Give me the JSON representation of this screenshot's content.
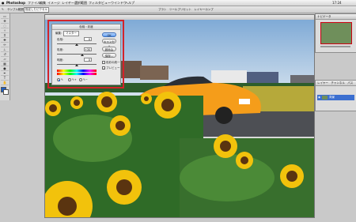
{
  "menubar": {
    "app_name": "Photoshop",
    "items": [
      "ファイル",
      "編集",
      "イメージ",
      "レイヤー",
      "選択範囲",
      "フィルタ",
      "ビュー",
      "ウインドウ",
      "ヘルプ"
    ],
    "clock": "17:24"
  },
  "options_bar": {
    "sample_label": "サンプル範囲：",
    "sample_value": "指定したピクセル",
    "right_tabs": "ブラシ　ツールプリセット　レイヤーカンプ"
  },
  "document": {
    "title": "",
    "colors": {
      "sky": "#a9c8e6",
      "field": "#3f7a2c",
      "sunflower": "#f2c20c",
      "car": "#f59d1a"
    }
  },
  "dialog": {
    "title": "色相・彩度",
    "edit_label": "編集：",
    "edit_value": "マスター",
    "hue_label": "色相：",
    "hue_value": "0",
    "saturation_label": "彩度：",
    "saturation_value": "+30",
    "lightness_label": "明度：",
    "lightness_value": "0",
    "ok_label": "OK",
    "cancel_label": "キャンセル",
    "load_label": "読み込み...",
    "save_label": "保存...",
    "colorize_label": "色彩の統一",
    "preview_label": "プレビュー",
    "preview_checked": true
  },
  "panels": {
    "navigator_title": "ナビゲータ",
    "layers_title": "レイヤー　チャンネル　パス",
    "layer_name": "背景"
  }
}
